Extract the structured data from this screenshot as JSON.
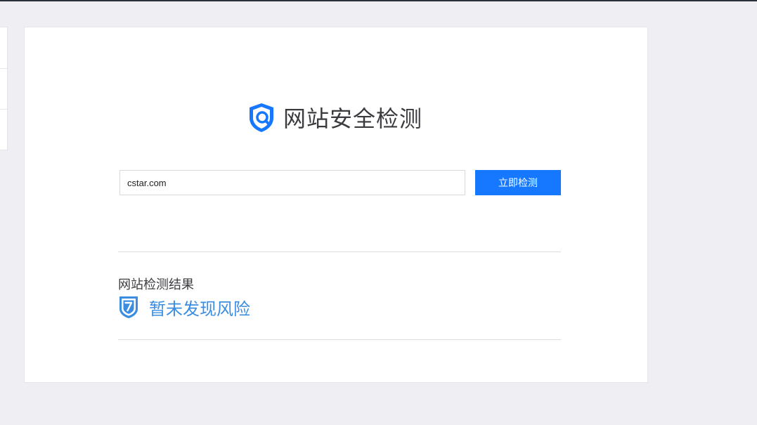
{
  "app": {
    "title": "网站安全检测"
  },
  "search": {
    "value": "cstar.com",
    "button_label": "立即检测"
  },
  "result": {
    "label": "网站检测结果",
    "status": "暂未发现风险"
  },
  "icons": {
    "logo": "shield-search-icon",
    "status": "shield-check-icon"
  },
  "colors": {
    "accent": "#1677ff",
    "status": "#3b8de2"
  }
}
